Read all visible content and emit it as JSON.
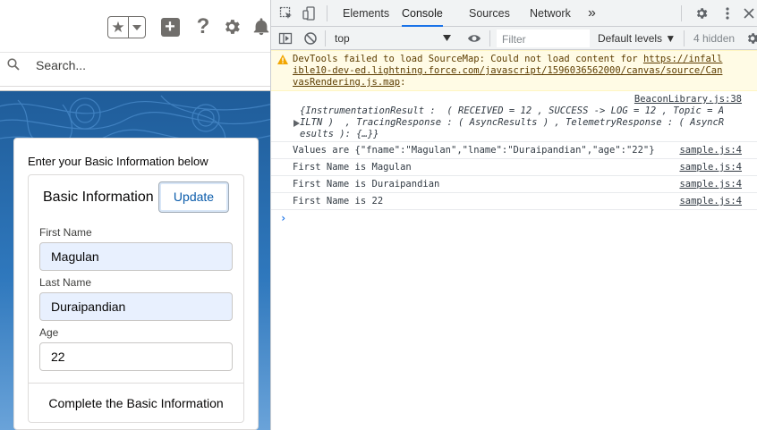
{
  "salesforce": {
    "search_placeholder": "Search...",
    "card_intro": "Enter your Basic Information below",
    "section_title": "Basic Information",
    "update_label": "Update",
    "fields": [
      {
        "label": "First Name",
        "value": "Magulan",
        "autofilled": true
      },
      {
        "label": "Last Name",
        "value": "Duraipandian",
        "autofilled": true
      },
      {
        "label": "Age",
        "value": "22",
        "autofilled": false
      }
    ],
    "footer": "Complete the Basic Information",
    "icons": [
      "star-icon",
      "chevron-down-icon",
      "add-icon",
      "help-icon",
      "gear-icon",
      "bell-icon",
      "search-icon"
    ]
  },
  "devtools": {
    "tabs": [
      "Elements",
      "Console",
      "Sources",
      "Network"
    ],
    "active_tab": "Console",
    "more_tabs": "»",
    "context": "top",
    "filter_placeholder": "Filter",
    "levels": "Default levels ▼",
    "hidden_count": "4 hidden",
    "messages": {
      "warning": {
        "line1_prefix": "DevTools failed to load SourceMap: Could not load content for ",
        "line1_link": "https://infall",
        "line2": "ible10-dev-ed.lightning.force.com/javascript/1596036562000/canvas/source/Can",
        "line3": "vasRendering.js.map",
        "line3_suffix": ":"
      },
      "beacon": {
        "source": "BeaconLibrary.js:38",
        "line1": "{InstrumentationResult :  ( RECEIVED = 12 , SUCCESS -> LOG = 12 , Topic = A",
        "line2": "ILTN )  , TracingResponse : ( AsyncResults ) , TelemetryResponse : ( AsyncR",
        "line3": "esults ): {…}}"
      },
      "logs": [
        {
          "text": "Values are {\"fname\":\"Magulan\",\"lname\":\"Duraipandian\",\"age\":\"22\"}",
          "source": "sample.js:4"
        },
        {
          "text": "First Name is Magulan",
          "source": "sample.js:4"
        },
        {
          "text": "First Name is Duraipandian",
          "source": "sample.js:4"
        },
        {
          "text": "First Name is 22",
          "source": "sample.js:4"
        }
      ],
      "prompt": "›"
    },
    "colors": {
      "tab_bar": "#f1f3f4",
      "active_underline": "#1a73e8",
      "warning_bg": "#fffbe5",
      "warning_icon": "#f2a600"
    }
  }
}
